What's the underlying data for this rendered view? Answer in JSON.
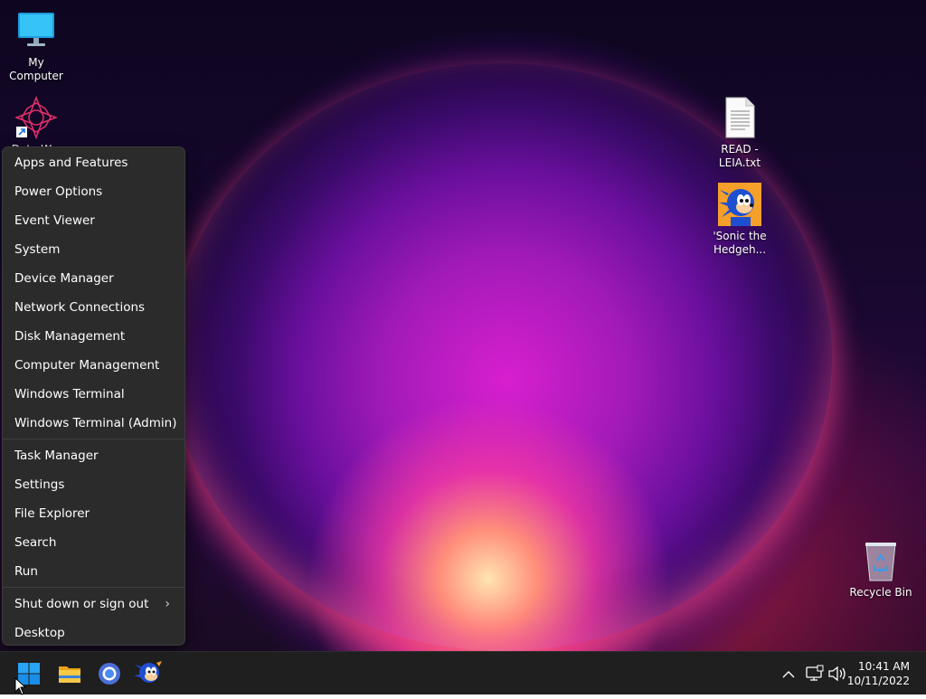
{
  "desktop": {
    "icons": [
      {
        "label": "My Computer"
      },
      {
        "label": "Data W..."
      },
      {
        "label": "READ - LEIA.txt"
      },
      {
        "label": "'Sonic the Hedgeh..."
      },
      {
        "label": "Recycle Bin"
      }
    ]
  },
  "menu": {
    "group1": [
      "Apps and Features",
      "Power Options",
      "Event Viewer",
      "System",
      "Device Manager",
      "Network Connections",
      "Disk Management",
      "Computer Management",
      "Windows Terminal",
      "Windows Terminal (Admin)"
    ],
    "group2": [
      "Task Manager",
      "Settings",
      "File Explorer",
      "Search",
      "Run"
    ],
    "group3": [
      "Shut down or sign out",
      "Desktop"
    ]
  },
  "taskbar": {
    "apps": [
      "start-icon",
      "file-explorer-icon",
      "browser-icon",
      "sonic-app-icon"
    ],
    "tray": {
      "time": "10:41 AM",
      "date": "10/11/2022"
    }
  },
  "colors": {
    "menu_bg": "#2b2b2b",
    "taskbar_bg": "#1f1f1f",
    "accent": "#0a84ff"
  }
}
